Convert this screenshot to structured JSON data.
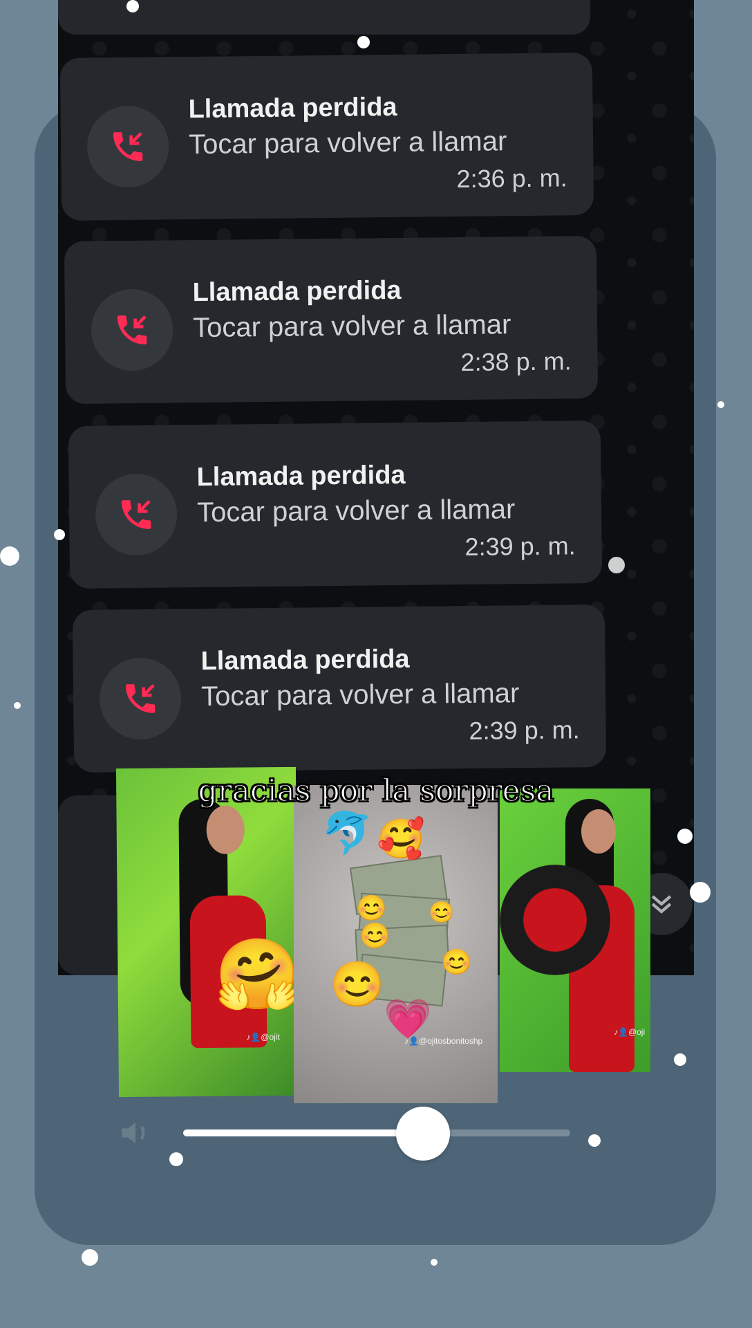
{
  "missed_calls": [
    {
      "title": "Llamada perdida",
      "subtitle": "Tocar para volver a llamar",
      "time": "2:36 p. m."
    },
    {
      "title": "Llamada perdida",
      "subtitle": "Tocar para volver a llamar",
      "time": "2:38 p. m."
    },
    {
      "title": "Llamada perdida",
      "subtitle": "Tocar para volver a llamar",
      "time": "2:39 p. m."
    },
    {
      "title": "Llamada perdida",
      "subtitle": "Tocar para volver a llamar",
      "time": "2:39 p. m."
    }
  ],
  "caption": "gracias por la sorpresa",
  "watermarks": {
    "photo1": "♪👤@ojit",
    "photo2": "♪👤@ojitosbonitoshp",
    "photo3": "♪👤@oji"
  },
  "icons": {
    "missed_call": "missed-call-icon",
    "scroll_down": "double-chevron-down-icon",
    "volume": "speaker-muted-icon"
  },
  "colors": {
    "missed_call_accent": "#ff2b54",
    "bubble": "#25282c",
    "volume_fill": "#ffffff"
  },
  "volume": {
    "level": 0.62
  }
}
